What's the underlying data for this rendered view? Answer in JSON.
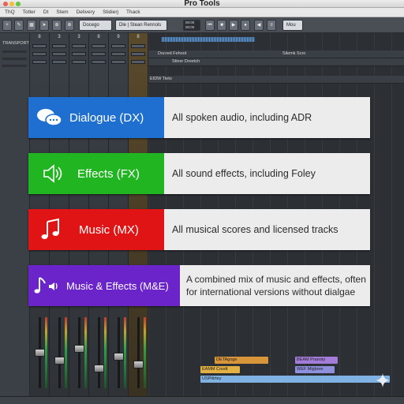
{
  "window": {
    "title": "Pro Tools"
  },
  "menu": [
    "ThQ",
    "Totter",
    "Dt",
    "Stem",
    "Delivery",
    "Stidierj",
    "Thack"
  ],
  "toolbar": {
    "field_left": "Docego",
    "field_mid": "Dle | Stean Rennols",
    "counter": "00:00\n00:00",
    "field_right": "Mou"
  },
  "left_panel": {
    "label": "TRANSPORT"
  },
  "mixer": {
    "strip_numbers": [
      "8",
      "3",
      "3",
      "8",
      "9",
      "8"
    ]
  },
  "edit": {
    "track_top_1": "Docred Fehoot",
    "track_top_2": "Stiner Dreetch",
    "track_top_3": "Silemk Scro",
    "track_top_4": "EIDW Tieto",
    "bottom_clips": [
      {
        "label": "DETAgoge",
        "color": "#d9953a"
      },
      {
        "label": "BEAM Pranoty",
        "color": "#a37bd8"
      },
      {
        "label": "EAMM Coodt",
        "color": "#e3b044"
      },
      {
        "label": "WEF Migbore",
        "color": "#8f8fe0"
      },
      {
        "label": "USPitirtey",
        "color": "#7fb1e3"
      }
    ]
  },
  "categories": [
    {
      "icon": "speech-bubbles-icon",
      "title": "Dialogue (DX)",
      "description": "All spoken audio, including ADR",
      "color": "#1f6fd1"
    },
    {
      "icon": "speaker-icon",
      "title": "Effects (FX)",
      "description": "All sound effects, including Foley",
      "color": "#22b522"
    },
    {
      "icon": "music-note-icon",
      "title": "Music (MX)",
      "description": "All musical scores and licensed tracks",
      "color": "#e01414"
    },
    {
      "icon": "music-speaker-icon",
      "title": "Music & Effects (M&E)",
      "description": "A combined mix of music and effects, often for international versions without dialgae",
      "color": "#6a24c9"
    }
  ]
}
